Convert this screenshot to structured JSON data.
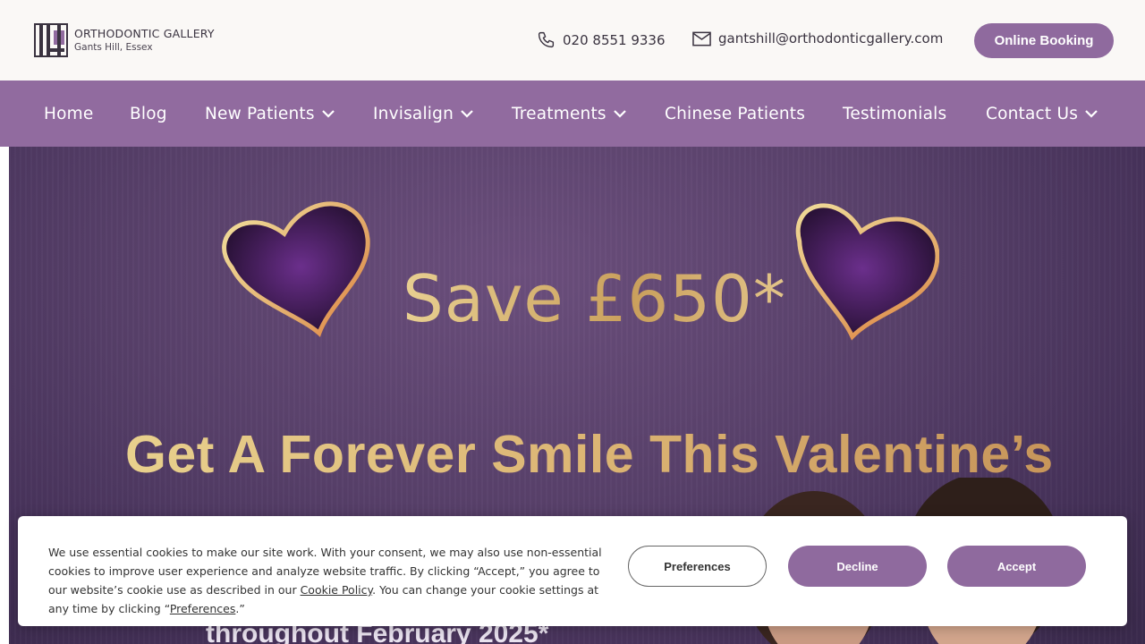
{
  "brand": {
    "name": "ORTHODONTIC GALLERY",
    "location": "Gants Hill, Essex",
    "colors": {
      "primary": "#916b9f",
      "button": "#8f6a9e",
      "gold": "#d8b776",
      "text": "#3a3340"
    }
  },
  "header": {
    "phone": "020 8551 9336",
    "email": "gantshill@orthodonticgallery.com",
    "booking_label": "Online Booking",
    "phone_icon": "phone-icon",
    "email_icon": "mail-icon"
  },
  "nav": {
    "items": [
      {
        "label": "Home",
        "has_dropdown": false
      },
      {
        "label": "Blog",
        "has_dropdown": false
      },
      {
        "label": "New Patients",
        "has_dropdown": true
      },
      {
        "label": "Invisalign",
        "has_dropdown": true
      },
      {
        "label": "Treatments",
        "has_dropdown": true
      },
      {
        "label": "Chinese Patients",
        "has_dropdown": false
      },
      {
        "label": "Testimonials",
        "has_dropdown": false
      },
      {
        "label": "Contact Us",
        "has_dropdown": true
      }
    ]
  },
  "hero": {
    "save_text": "Save £650*",
    "headline": "Get A Forever Smile This Valentine’s",
    "subline": "throughout February 2025*"
  },
  "cookie": {
    "text_part1": "We use essential cookies to make our site work. With your consent, we may also use non-essential cookies to improve user experience and analyze website traffic. By clicking “Accept,” you agree to our website’s cookie use as described in our ",
    "policy_link": "Cookie Policy",
    "text_part2": ". You can change your cookie settings at any time by clicking “",
    "preferences_link": "Preferences",
    "text_part3": ".”",
    "preferences_button": "Preferences",
    "decline_button": "Decline",
    "accept_button": "Accept"
  }
}
